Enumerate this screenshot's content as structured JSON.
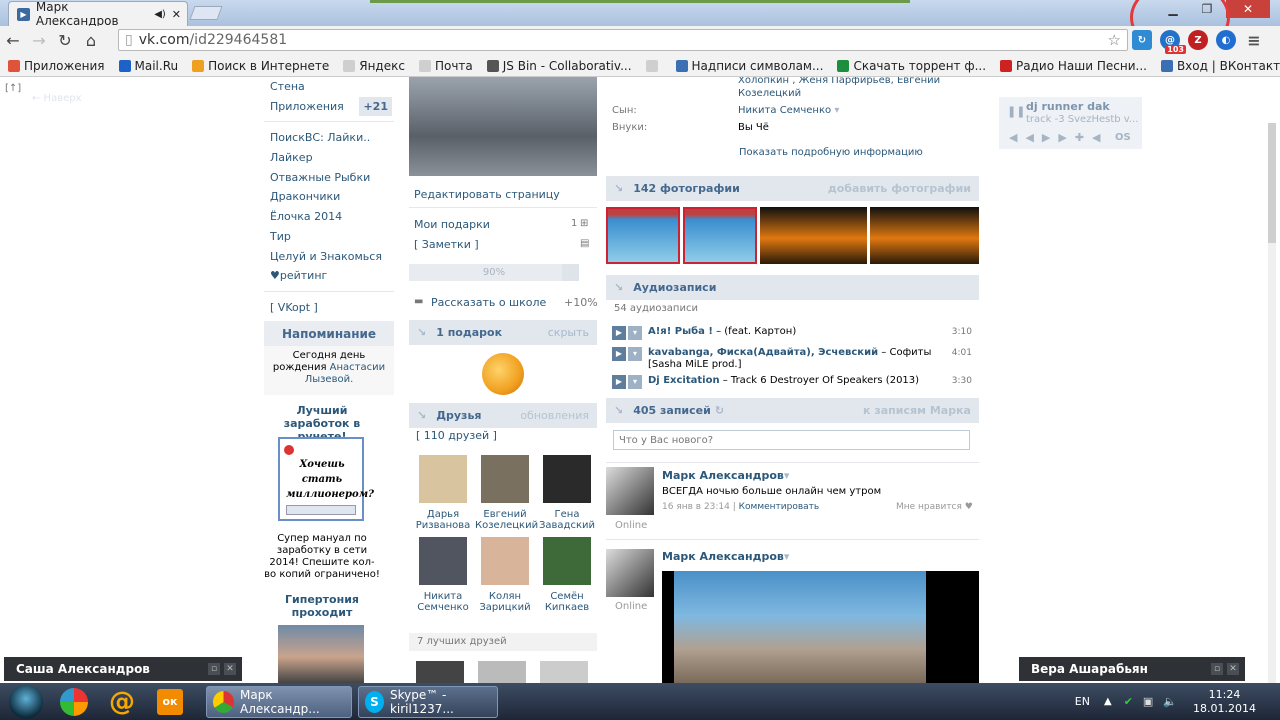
{
  "browser": {
    "tab_title": "Марк Александров",
    "url_prefix": "vk.com",
    "url_path": "/id229464581",
    "bookmarks": [
      {
        "label": "Приложения",
        "color": "#e0533b"
      },
      {
        "label": "Mail.Ru",
        "color": "#1d62c9"
      },
      {
        "label": "Поиск в Интернете",
        "color": "#f0a020"
      },
      {
        "label": "Яндекс",
        "color": "#cfcfcf"
      },
      {
        "label": "Почта",
        "color": "#cfcfcf"
      },
      {
        "label": "JS Bin - Collaborativ...",
        "color": "#555555"
      },
      {
        "label": "",
        "color": "#cfcfcf"
      },
      {
        "label": "Надписи символам...",
        "color": "#3a6fb3"
      },
      {
        "label": "Скачать торрент ф...",
        "color": "#1d8e3c"
      },
      {
        "label": "Радио Наши Песни...",
        "color": "#cc2222"
      },
      {
        "label": "Вход | ВКонтакте",
        "color": "#3a6fb3"
      }
    ],
    "ext_badge": "103"
  },
  "left_menu": {
    "items": [
      "Стена",
      "Приложения"
    ],
    "apps_count": "+21",
    "apps": [
      "ПоискВС: Лайки..",
      "Лайкер",
      "Отважные Рыбки",
      "Дракончики",
      "Ёлочка 2014",
      "Тир",
      "Целуй и Знакомься",
      "♥рейтинг"
    ],
    "vkopt": "[ VKopt ]",
    "reminder_title": "Напоминание",
    "reminder_text1": "Сегодня",
    "reminder_text2": "день рождения",
    "reminder_name": "Анастасии Лызевой.",
    "ad_title": "Лучший заработок в рунете!",
    "ad_banner": "Хочешь стать миллионером?",
    "ad_text": "Супер мануал по заработку в сети 2014! Спешите кол-во копий ограничено!",
    "ad2_title": "Гипертония проходит",
    "top_left_marker": "[↑]"
  },
  "profile": {
    "edit_page": "Редактировать страницу",
    "gifts_label": "Мои подарки",
    "gifts_count": "1",
    "notes_label": "[ Заметки ]",
    "progress_text": "90%",
    "progress": 0.9,
    "school_label": "Рассказать о школе",
    "school_bonus": "+10%",
    "gift_block_title": "1 подарок",
    "gift_block_hide": "скрыть",
    "friends_title": "Друзья",
    "friends_updates": "обновления",
    "friends_count": "[ 110 друзей ]",
    "friends": [
      {
        "first": "Дарья",
        "last": "Ризванова",
        "color": "#d9c4a0"
      },
      {
        "first": "Евгений",
        "last": "Козелецкий",
        "color": "#7a7060"
      },
      {
        "first": "Гена",
        "last": "Завадский",
        "color": "#2a2a2a"
      },
      {
        "first": "Никита",
        "last": "Семченко",
        "color": "#505560"
      },
      {
        "first": "Колян",
        "last": "Зарицкий",
        "color": "#d8b49a"
      },
      {
        "first": "Семён",
        "last": "Кипкаев",
        "color": "#3e6a3a"
      }
    ],
    "best_friends": "7 лучших друзей"
  },
  "info": {
    "relatives_top": "Холопкин , Женя Парфирьев, Евгений Козелецкий",
    "son_label": "Сын:",
    "son_value": "Никита Семченко",
    "grandchildren_label": "Внуки:",
    "grandchildren_value": "Вы Чё",
    "show_more": "Показать подробную информацию",
    "photos_title": "142 фотографии",
    "photos_add": "добавить фотографии",
    "audio_title": "Аудиозаписи",
    "audio_count": "54 аудиозаписи",
    "tracks": [
      {
        "artist": "А!я! Рыба !",
        "title": " – (feat. Картон)",
        "time": "3:10"
      },
      {
        "artist": "kavabanga, Фиска(Адвайта), Эсчевский",
        "title": " – Софиты [Sasha MiLE prod.]",
        "time": "4:01"
      },
      {
        "artist": "Dj Excitation",
        "title": " – Track 6 Destroyer Of Speakers (2013)",
        "time": "3:30"
      }
    ],
    "wall_title": "405 записей",
    "wall_link": "к записям Марка",
    "wall_placeholder": "Что у Вас нового?",
    "post1_author": "Марк Александров",
    "post1_text": "ВСЕГДА ночью больше онлайн чем утром",
    "post1_date": "16 янв в 23:14",
    "post1_comment": "Комментировать",
    "post1_like": "Мне нравится",
    "online1": "Online",
    "post2_author": "Марк Александров",
    "online2": "Online"
  },
  "player": {
    "artist": "dj runner dak",
    "track": "track -3 SvezHestb v...",
    "os": "OS"
  },
  "chats": {
    "left": "Саша Александров",
    "right": "Вера Ашарабьян"
  },
  "taskbar": {
    "chrome_label": "Марк Александр...",
    "skype_label": "Skype™ - kiril1237...",
    "lang": "EN",
    "time": "11:24",
    "date": "18.01.2014"
  }
}
